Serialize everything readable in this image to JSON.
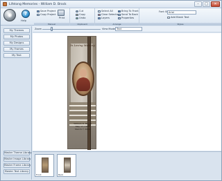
{
  "window": {
    "title": "Lifelong Memories - William D. Brock",
    "minimize_glyph": "–",
    "maximize_glyph": "□",
    "close_glyph": "✕"
  },
  "ribbon": {
    "app_button_glyph": "◉",
    "help_label": "Help",
    "groups": {
      "file": {
        "caption": "Manual",
        "save_project": "Save Project",
        "copy_project": "Copy Project",
        "print_label": "Print"
      },
      "clipboard": {
        "caption": "Clipboard",
        "cut": "Cut",
        "copy": "Copy",
        "undo": "Undo"
      },
      "arrange": {
        "caption": "Arrange",
        "select_all": "Select All",
        "clear_selection": "Clear Selection",
        "layers": "Layers",
        "bring_to_front": "Bring To Front",
        "send_to_back": "Send To Back",
        "properties": "Properties"
      },
      "text": {
        "caption": "Styles",
        "font_label": "Font Size",
        "font_value": "Arial",
        "add_blank_text": "Add Blank Text"
      }
    }
  },
  "subtoolbar": {
    "zoom_label": "Zoom",
    "view_label": "View Mode",
    "view_value": "Text"
  },
  "sidebar": {
    "top_buttons": [
      "My Themes",
      "My Photos",
      "My Designs",
      "My Frames",
      "My Text"
    ],
    "bottom_buttons": [
      "Master Theme Library",
      "Master Image Library",
      "Master Frame Library",
      "Master Text Library"
    ]
  },
  "page": {
    "heading": "In Loving Memory",
    "lines": [
      "William D. Brock",
      "May 17, 1933",
      "March 7, 2009"
    ]
  },
  "thumbnails": [
    {
      "label": "Front"
    },
    {
      "label": "Back"
    }
  ]
}
